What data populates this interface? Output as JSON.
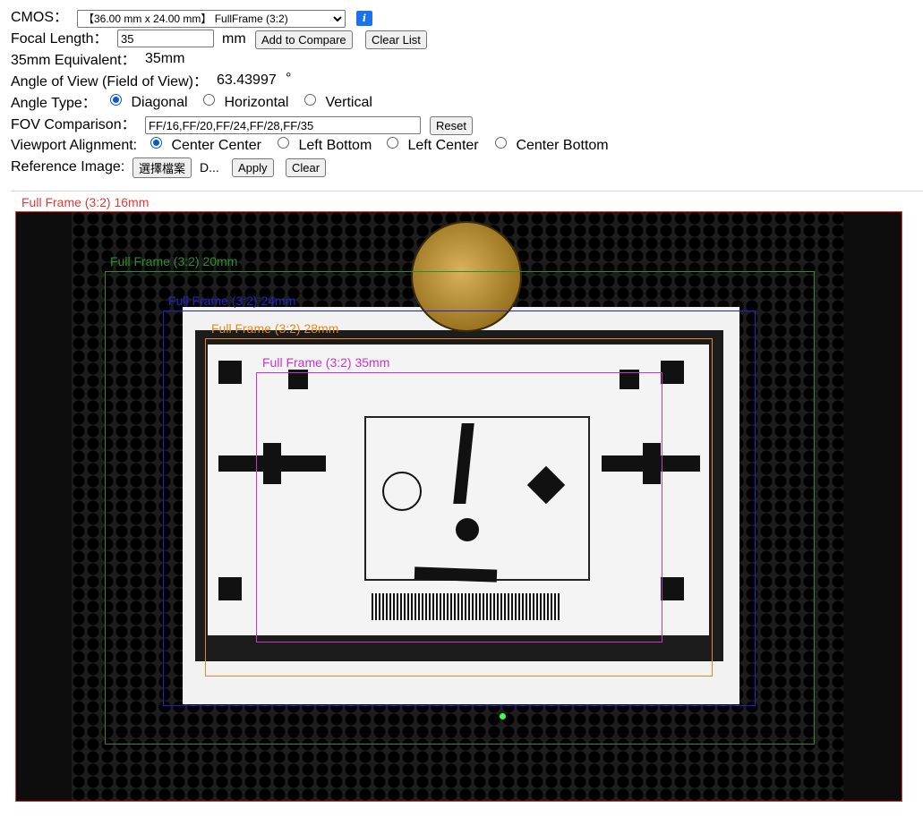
{
  "controls": {
    "cmos_label": "CMOS：",
    "cmos_selected": "【36.00 mm x 24.00 mm】 FullFrame (3:2)",
    "info_label": "i",
    "focal_label": "Focal Length：",
    "focal_value": "35",
    "focal_unit": "mm",
    "add_compare": "Add to Compare",
    "clear_list": "Clear List",
    "equiv_label": "35mm Equivalent：",
    "equiv_value": "35mm",
    "aov_label": "Angle of View (Field of View)：",
    "aov_value": "63.43997",
    "aov_unit": "°",
    "angle_type_label": "Angle Type：",
    "angle_types": [
      {
        "label": "Diagonal",
        "checked": true
      },
      {
        "label": "Horizontal",
        "checked": false
      },
      {
        "label": "Vertical",
        "checked": false
      }
    ],
    "fov_label": "FOV Comparison：",
    "fov_value": "FF/16,FF/20,FF/24,FF/28,FF/35",
    "reset": "Reset",
    "viewport_label": "Viewport Alignment:",
    "alignments": [
      {
        "label": "Center Center",
        "checked": true
      },
      {
        "label": "Left Bottom",
        "checked": false
      },
      {
        "label": "Left Center",
        "checked": false
      },
      {
        "label": "Center Bottom",
        "checked": false
      }
    ],
    "ref_label": "Reference Image:",
    "choose_file": "選擇檔案",
    "file_name": "D...",
    "apply": "Apply",
    "clear": "Clear"
  },
  "viewport": {
    "frames": [
      {
        "label": "Full Frame (3:2) 16mm",
        "color": "#e53935"
      },
      {
        "label": "Full Frame (3:2) 20mm",
        "color": "#2e8b2e"
      },
      {
        "label": "Full Frame (3:2) 24mm",
        "color": "#2222cc"
      },
      {
        "label": "Full Frame (3:2) 28mm",
        "color": "#e8891a"
      },
      {
        "label": "Full Frame (3:2) 35mm",
        "color": "#cc33cc"
      }
    ]
  }
}
